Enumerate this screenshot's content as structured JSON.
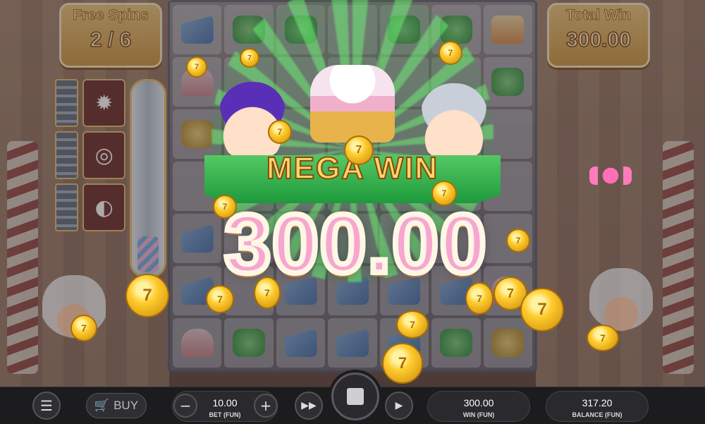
{
  "free_spins": {
    "label": "Free Spins",
    "value": "2 / 6"
  },
  "total_win": {
    "label": "Total Win",
    "value": "300.00"
  },
  "overlay": {
    "banner": "MEGA WIN",
    "amount": "300.00"
  },
  "controls": {
    "buy_label": "BUY",
    "bet_value": "10.00",
    "bet_label": "BET (FUN)",
    "win_value": "300.00",
    "win_label": "WIN (FUN)",
    "balance_value": "317.20",
    "balance_label": "BALANCE (FUN)"
  },
  "icons": [
    "menu-icon",
    "cart-icon",
    "minus-icon",
    "plus-icon",
    "fast-forward-icon",
    "stop-icon",
    "play-icon",
    "coin-icon",
    "candy-icon"
  ],
  "colors": {
    "banner_green": "#2fb84a",
    "donut_pink": "#f7a6cf",
    "gold": "#ffcb2e",
    "bar": "#1c1c1e"
  }
}
